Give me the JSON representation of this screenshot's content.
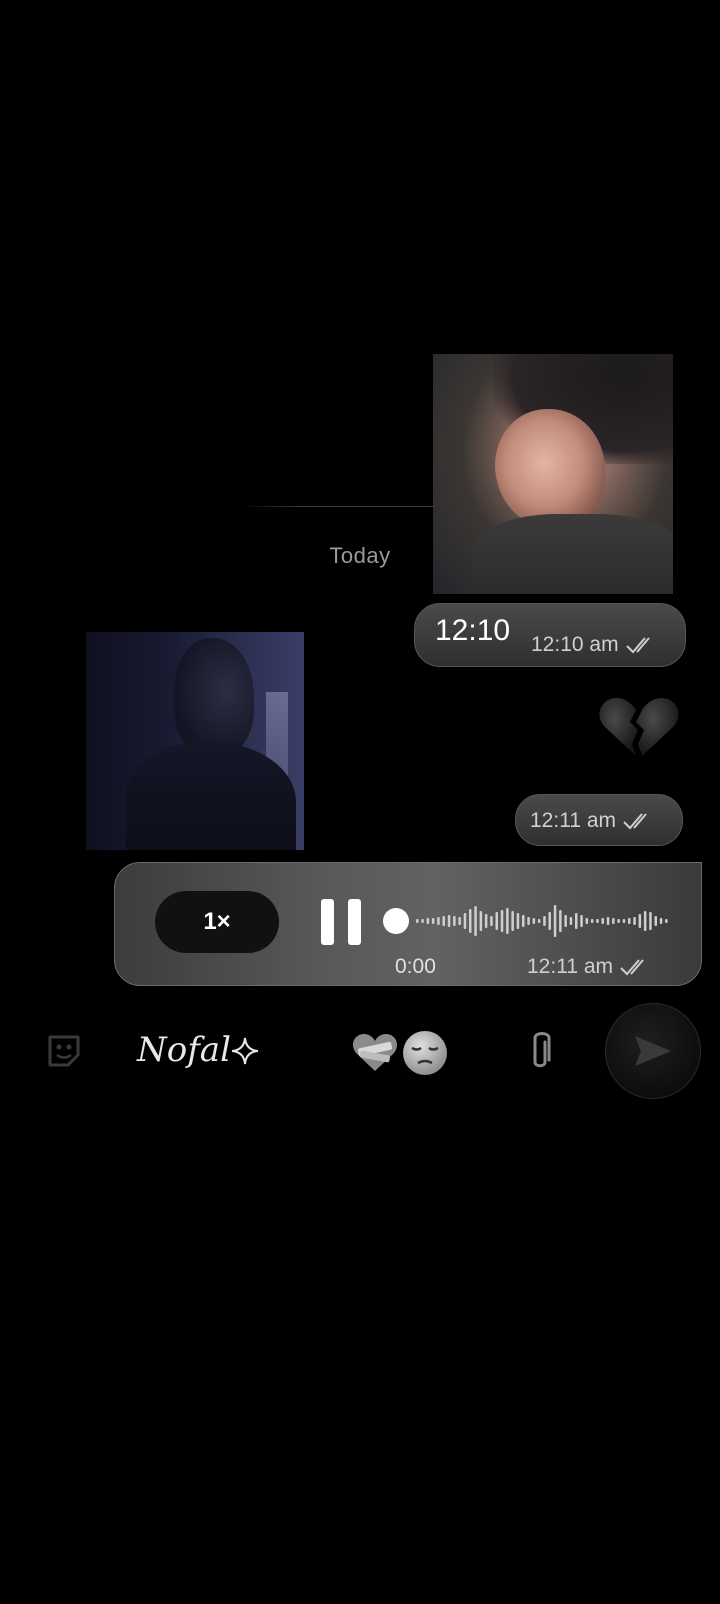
{
  "chat": {
    "date_separator": "Today",
    "messages": [
      {
        "type": "image",
        "side": "right",
        "description_icon": "photo"
      },
      {
        "type": "text",
        "side": "right",
        "text": "12:10",
        "time": "12:10 am",
        "status_icon": "double-check-icon"
      },
      {
        "type": "image",
        "side": "left",
        "description_icon": "photo"
      },
      {
        "type": "emoji",
        "side": "right",
        "emoji_icon": "broken-heart-icon",
        "time": "12:11 am",
        "status_icon": "double-check-icon"
      },
      {
        "type": "voice",
        "side": "right",
        "speed_label": "1×",
        "elapsed": "0:00",
        "time": "12:11 am",
        "status_icon": "double-check-icon",
        "playback_state": "playing",
        "progress": 0.0
      }
    ]
  },
  "composer": {
    "sticker_icon": "sticker-icon",
    "text": "Nofal",
    "sparkle_icon": "sparkle-icon",
    "emoji_icons": [
      "mending-heart-icon",
      "pensive-face-icon"
    ],
    "attach_icon": "paperclip-icon",
    "send_icon": "send-icon"
  }
}
